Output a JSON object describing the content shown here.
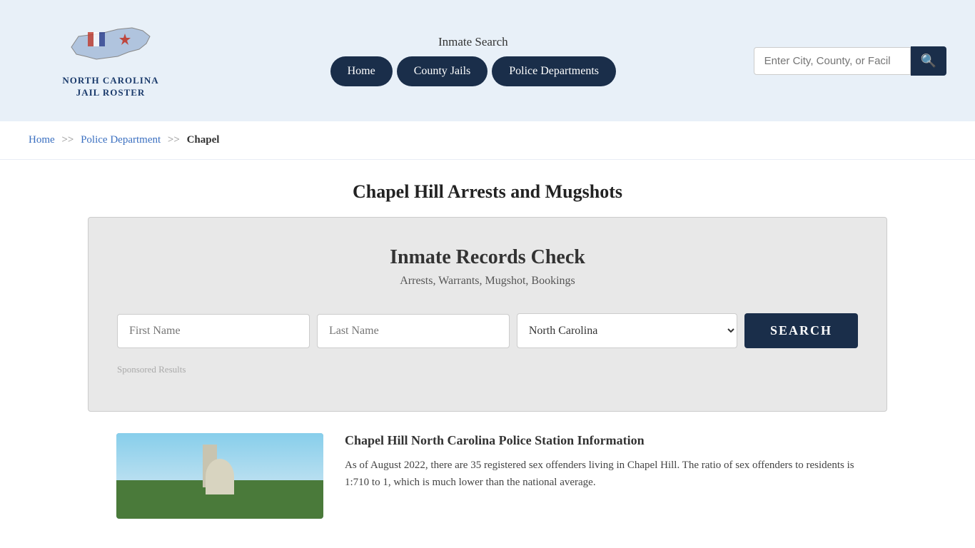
{
  "header": {
    "logo_line1": "NORTH CAROLINA",
    "logo_line2": "JAIL ROSTER",
    "inmate_search_label": "Inmate Search",
    "nav": {
      "home": "Home",
      "county_jails": "County Jails",
      "police_departments": "Police Departments"
    },
    "search_placeholder": "Enter City, County, or Facil"
  },
  "breadcrumb": {
    "home": "Home",
    "sep1": ">>",
    "police_dept": "Police Department",
    "sep2": ">>",
    "current": "Chapel"
  },
  "page": {
    "title": "Chapel Hill Arrests and Mugshots"
  },
  "records_box": {
    "title": "Inmate Records Check",
    "subtitle": "Arrests, Warrants, Mugshot, Bookings",
    "first_name_placeholder": "First Name",
    "last_name_placeholder": "Last Name",
    "state_default": "North Carolina",
    "search_button": "SEARCH",
    "sponsored_label": "Sponsored Results"
  },
  "bottom_section": {
    "heading": "Chapel Hill North Carolina Police Station Information",
    "body": "As of August 2022, there are 35 registered sex offenders living in Chapel Hill. The ratio of sex offenders to residents is 1:710 to 1, which is much lower than the national average."
  }
}
